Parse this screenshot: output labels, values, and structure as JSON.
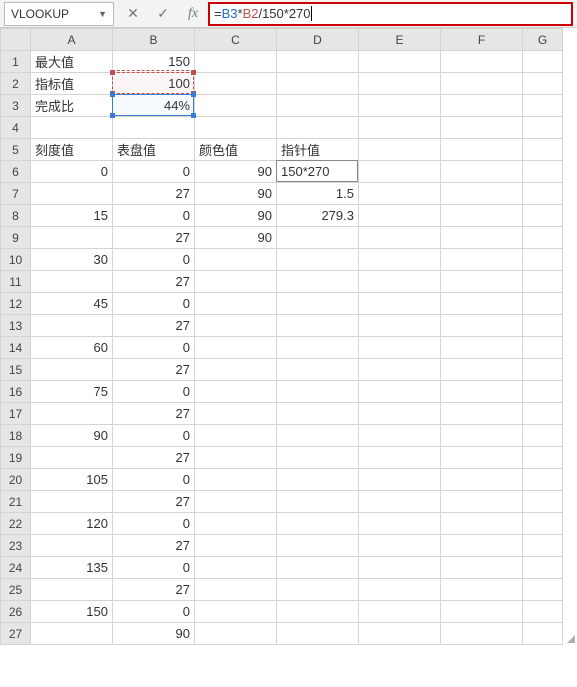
{
  "nameBox": "VLOOKUP",
  "formulaBar": {
    "prefix": "=",
    "ref1": "B3",
    "op1": "*",
    "ref2": "B2",
    "rest": "/150*270"
  },
  "columns": [
    "A",
    "B",
    "C",
    "D",
    "E",
    "F",
    "G"
  ],
  "rowCount": 27,
  "cells": {
    "A1": {
      "v": "最大值",
      "align": "left"
    },
    "B1": {
      "v": "150",
      "align": "right"
    },
    "A2": {
      "v": "指标值",
      "align": "left"
    },
    "B2": {
      "v": "100",
      "align": "right"
    },
    "A3": {
      "v": "完成比",
      "align": "left"
    },
    "B3": {
      "v": "44%",
      "align": "right"
    },
    "A5": {
      "v": "刻度值",
      "align": "left"
    },
    "B5": {
      "v": "表盘值",
      "align": "left"
    },
    "C5": {
      "v": "颜色值",
      "align": "left"
    },
    "D5": {
      "v": "指针值",
      "align": "left"
    },
    "A6": {
      "v": "0",
      "align": "right"
    },
    "B6": {
      "v": "0",
      "align": "right"
    },
    "C6": {
      "v": "90",
      "align": "right"
    },
    "D6": {
      "v": "150*270",
      "align": "left"
    },
    "B7": {
      "v": "27",
      "align": "right"
    },
    "C7": {
      "v": "90",
      "align": "right"
    },
    "D7": {
      "v": "1.5",
      "align": "right"
    },
    "A8": {
      "v": "15",
      "align": "right"
    },
    "B8": {
      "v": "0",
      "align": "right"
    },
    "C8": {
      "v": "90",
      "align": "right"
    },
    "D8": {
      "v": "279.3",
      "align": "right"
    },
    "B9": {
      "v": "27",
      "align": "right"
    },
    "C9": {
      "v": "90",
      "align": "right"
    },
    "A10": {
      "v": "30",
      "align": "right"
    },
    "B10": {
      "v": "0",
      "align": "right"
    },
    "B11": {
      "v": "27",
      "align": "right"
    },
    "A12": {
      "v": "45",
      "align": "right"
    },
    "B12": {
      "v": "0",
      "align": "right"
    },
    "B13": {
      "v": "27",
      "align": "right"
    },
    "A14": {
      "v": "60",
      "align": "right"
    },
    "B14": {
      "v": "0",
      "align": "right"
    },
    "B15": {
      "v": "27",
      "align": "right"
    },
    "A16": {
      "v": "75",
      "align": "right"
    },
    "B16": {
      "v": "0",
      "align": "right"
    },
    "B17": {
      "v": "27",
      "align": "right"
    },
    "A18": {
      "v": "90",
      "align": "right"
    },
    "B18": {
      "v": "0",
      "align": "right"
    },
    "B19": {
      "v": "27",
      "align": "right"
    },
    "A20": {
      "v": "105",
      "align": "right"
    },
    "B20": {
      "v": "0",
      "align": "right"
    },
    "B21": {
      "v": "27",
      "align": "right"
    },
    "A22": {
      "v": "120",
      "align": "right"
    },
    "B22": {
      "v": "0",
      "align": "right"
    },
    "B23": {
      "v": "27",
      "align": "right"
    },
    "A24": {
      "v": "135",
      "align": "right"
    },
    "B24": {
      "v": "0",
      "align": "right"
    },
    "B25": {
      "v": "27",
      "align": "right"
    },
    "A26": {
      "v": "150",
      "align": "right"
    },
    "B26": {
      "v": "0",
      "align": "right"
    },
    "B27": {
      "v": "90",
      "align": "right"
    }
  },
  "chart_data": {
    "type": "table",
    "title": "Gauge chart source data",
    "parameters": {
      "最大值": 150,
      "指标值": 100,
      "完成比": 0.44
    },
    "series": [
      {
        "name": "刻度值",
        "values": [
          0,
          null,
          15,
          null,
          30,
          null,
          45,
          null,
          60,
          null,
          75,
          null,
          90,
          null,
          105,
          null,
          120,
          null,
          135,
          null,
          150,
          null
        ]
      },
      {
        "name": "表盘值",
        "values": [
          0,
          27,
          0,
          27,
          0,
          27,
          0,
          27,
          0,
          27,
          0,
          27,
          0,
          27,
          0,
          27,
          0,
          27,
          0,
          27,
          0,
          90
        ]
      },
      {
        "name": "颜色值",
        "values": [
          90,
          90,
          90,
          90
        ]
      },
      {
        "name": "指针值",
        "values": [
          "=B3*B2/150*270",
          1.5,
          279.3
        ]
      }
    ]
  }
}
